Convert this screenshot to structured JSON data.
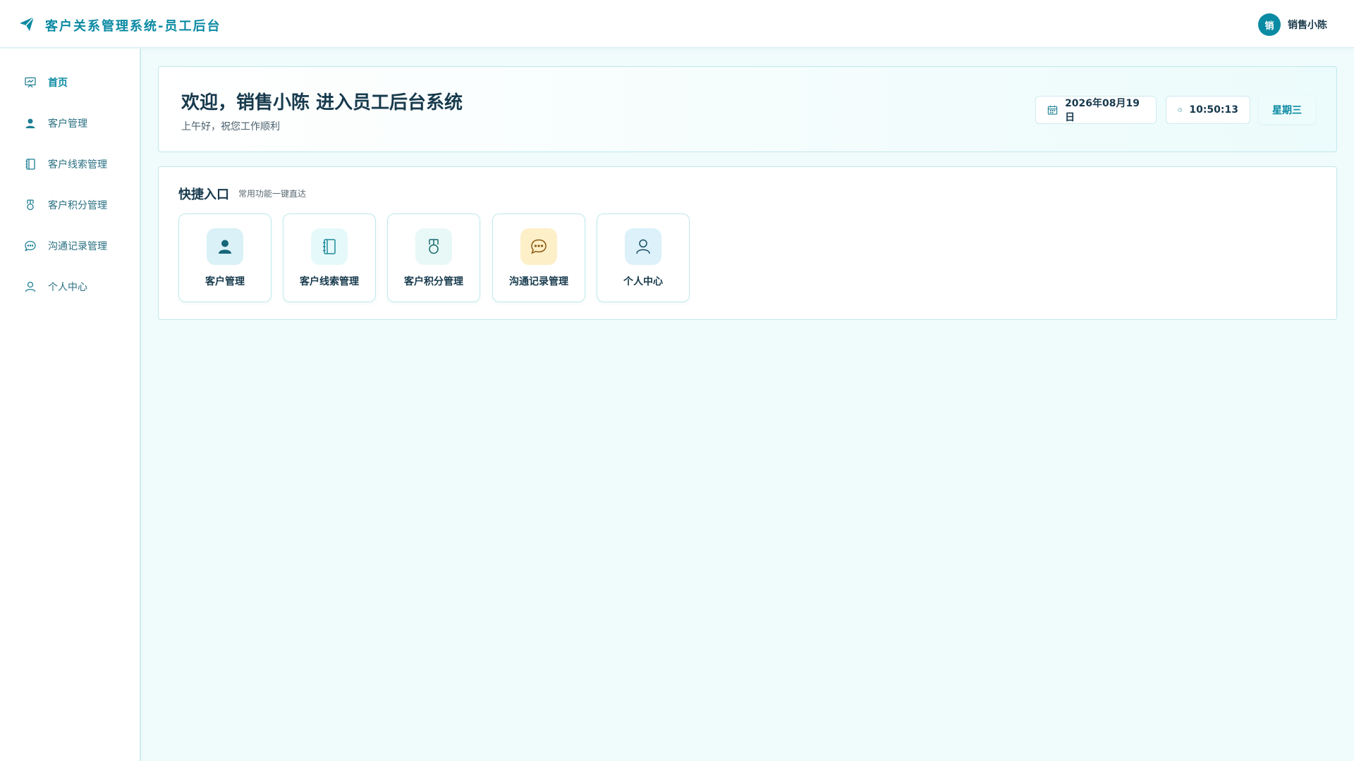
{
  "header": {
    "title": "客户关系管理系统-员工后台",
    "avatar_text": "销",
    "user_name": "销售小陈"
  },
  "sidebar": {
    "items": [
      {
        "label": "首页",
        "icon": "chart-board-icon",
        "active": true
      },
      {
        "label": "客户管理",
        "icon": "user-solid-icon"
      },
      {
        "label": "客户线索管理",
        "icon": "notebook-icon"
      },
      {
        "label": "客户积分管理",
        "icon": "medal-icon"
      },
      {
        "label": "沟通记录管理",
        "icon": "chat-bubble-icon"
      },
      {
        "label": "个人中心",
        "icon": "user-outline-icon"
      }
    ]
  },
  "welcome": {
    "title": "欢迎，销售小陈 进入员工后台系统",
    "subtitle": "上午好，祝您工作顺利",
    "date": "2026年08月19日",
    "time": "10:50:13",
    "weekday": "星期三"
  },
  "quick": {
    "title": "快捷入口",
    "subtitle": "常用功能一键直达",
    "tiles": [
      {
        "label": "客户管理",
        "icon": "user-solid-icon",
        "bg": "#d9f1f7"
      },
      {
        "label": "客户线索管理",
        "icon": "notebook-icon",
        "bg": "#e6f9fa"
      },
      {
        "label": "客户积分管理",
        "icon": "medal-icon",
        "bg": "#e8f8f6"
      },
      {
        "label": "沟通记录管理",
        "icon": "chat-bubble-icon",
        "bg": "#fdefc8"
      },
      {
        "label": "个人中心",
        "icon": "user-outline-icon",
        "bg": "#dcf1fa"
      }
    ]
  },
  "colors": {
    "accent": "#0b8aa3",
    "background": "#f0fbfb",
    "border": "#bfe9ec"
  }
}
